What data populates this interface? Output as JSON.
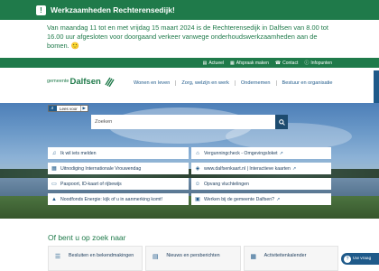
{
  "alert": {
    "title": "Werkzaamheden Rechterensedijk!",
    "text": "Van maandag 11 tot en met vrijdag 15 maart 2024 is de Rechterensedijk in Dalfsen van 8.00 tot 16.00 uur afgesloten voor doorgaand verkeer vanwege onderhoudswerkzaamheden aan de bomen. 🙂"
  },
  "utility_links": [
    {
      "icon": "newspaper-icon",
      "glyph": "▤",
      "label": "Actueel"
    },
    {
      "icon": "calendar-icon",
      "glyph": "▦",
      "label": "Afspraak maken"
    },
    {
      "icon": "phone-icon",
      "glyph": "☎",
      "label": "Contact"
    },
    {
      "icon": "info-icon",
      "glyph": "ⓘ",
      "label": "Infopunten"
    }
  ],
  "logo": {
    "prefix": "gemeente",
    "name": "Dalfsen"
  },
  "nav": [
    "Wonen en leven",
    "Zorg, welzijn en werk",
    "Ondernemen",
    "Bestuur en organisatie"
  ],
  "readaloud": {
    "label": "Lees voor"
  },
  "search": {
    "placeholder": "Zoeken"
  },
  "quick_links": {
    "left": [
      {
        "icon": "megaphone-icon",
        "glyph": "♫",
        "label": "Ik wil iets melden"
      },
      {
        "icon": "calendar-icon",
        "glyph": "▦",
        "label": "Uitnodiging Internationale Vrouwendag"
      },
      {
        "icon": "id-card-icon",
        "glyph": "▭",
        "label": "Paspoort, ID-kaart of rijbewijs"
      },
      {
        "icon": "warning-icon",
        "glyph": "▲",
        "label": "Noodfonds Energie: kijk of u in aanmerking komt!"
      }
    ],
    "right": [
      {
        "icon": "house-check-icon",
        "glyph": "⌂",
        "label": "Vergunningcheck - Omgevingsloket",
        "external": true
      },
      {
        "icon": "map-icon",
        "glyph": "◈",
        "label": "www.dalfsenkaart.nl | Interactieve kaarten",
        "external": true
      },
      {
        "icon": "people-icon",
        "glyph": "☺",
        "label": "Opvang vluchtelingen",
        "external": false
      },
      {
        "icon": "briefcase-icon",
        "glyph": "▣",
        "label": "Werken bij de gemeente Dalfsen?",
        "external": true
      }
    ]
  },
  "section": {
    "title": "Of bent u op zoek naar"
  },
  "cards": [
    {
      "icon": "document-icon",
      "glyph": "☰",
      "label": "Besluiten en bekendmakingen"
    },
    {
      "icon": "news-icon",
      "glyph": "▤",
      "label": "Nieuws en persberichten"
    },
    {
      "icon": "calendar-icon",
      "glyph": "▦",
      "label": "Activiteitenkalender"
    }
  ],
  "help": {
    "label": "Uw vraag"
  },
  "colors": {
    "brand_green": "#1f7a4a",
    "link_blue": "#1f5a8a",
    "search_button": "#1d4b6f"
  }
}
